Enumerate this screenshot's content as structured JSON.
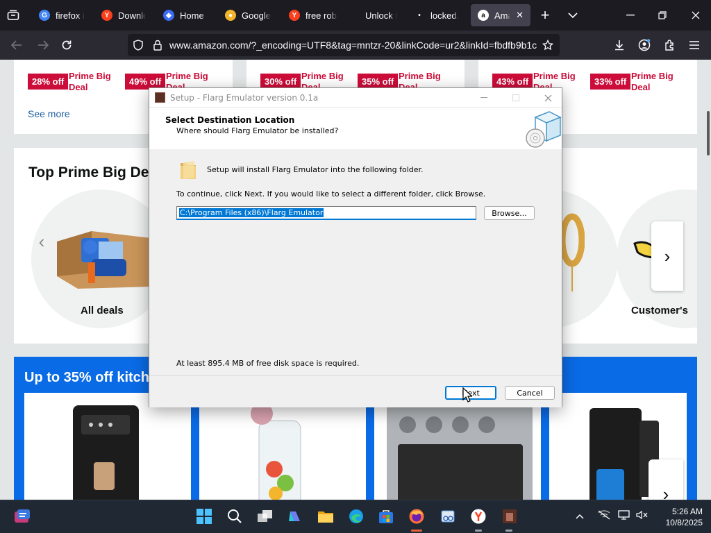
{
  "browser": {
    "tabs": [
      {
        "label": "firefox is",
        "favicon": "google-icon",
        "color": "#4285f4",
        "glyph": "G"
      },
      {
        "label": "Downloa",
        "favicon": "yandex-icon",
        "color": "#fc3f1d",
        "glyph": "Y"
      },
      {
        "label": "Home - I",
        "favicon": "roblox-icon",
        "color": "#3b6cf5",
        "glyph": "◆"
      },
      {
        "label": "Google C",
        "favicon": "chrome-icon",
        "color": "#f2b42b",
        "glyph": "●"
      },
      {
        "label": "free robu",
        "favicon": "yandex-icon",
        "color": "#fc3f1d",
        "glyph": "Y"
      },
      {
        "label": "Unlock Robu",
        "favicon": "blank-icon",
        "color": "#1c1b22",
        "glyph": ""
      },
      {
        "label": "locked.g",
        "favicon": "dot-icon",
        "color": "#1c1b22",
        "glyph": "•"
      },
      {
        "label": "Amaz",
        "favicon": "amazon-icon",
        "color": "#ffffff",
        "glyph": "a"
      }
    ],
    "url": "www.amazon.com/?_encoding=UTF8&tag=mntzr-20&linkCode=ur2&linkId=fbdfb9b1c"
  },
  "amazon": {
    "deals_row": [
      {
        "badge": "28% off",
        "label": "Prime Big Deal"
      },
      {
        "badge": "49% off",
        "label": "Prime Big Deal"
      },
      {
        "badge": "30% off",
        "label": "Prime Big Deal"
      },
      {
        "badge": "35% off",
        "label": "Prime Big Deal"
      },
      {
        "badge": "43% off",
        "label": "Prime Big Deal"
      },
      {
        "badge": "33% off",
        "label": "Prime Big Deal"
      }
    ],
    "see_more": "See more",
    "top_deals_title": "Top Prime Big De",
    "categories": {
      "left": "All deals",
      "right": "Customer's"
    },
    "kitchen_title": "Up to 35% off kitch"
  },
  "dialog": {
    "title": "Setup - Flarg Emulator version 0.1a",
    "header_title": "Select Destination Location",
    "header_sub": "Where should Flarg Emulator be installed?",
    "install_text": "Setup will install Flarg Emulator into the following folder.",
    "continue_text": "To continue, click Next. If you would like to select a different folder, click Browse.",
    "path": "C:\\Program Files (x86)\\Flarg Emulator",
    "browse_label": "Browse...",
    "disk_text": "At least 895.4 MB of free disk space is required.",
    "next_label": "Next",
    "cancel_label": "Cancel"
  },
  "taskbar": {
    "time": "5:26 AM",
    "date": "10/8/2025"
  }
}
